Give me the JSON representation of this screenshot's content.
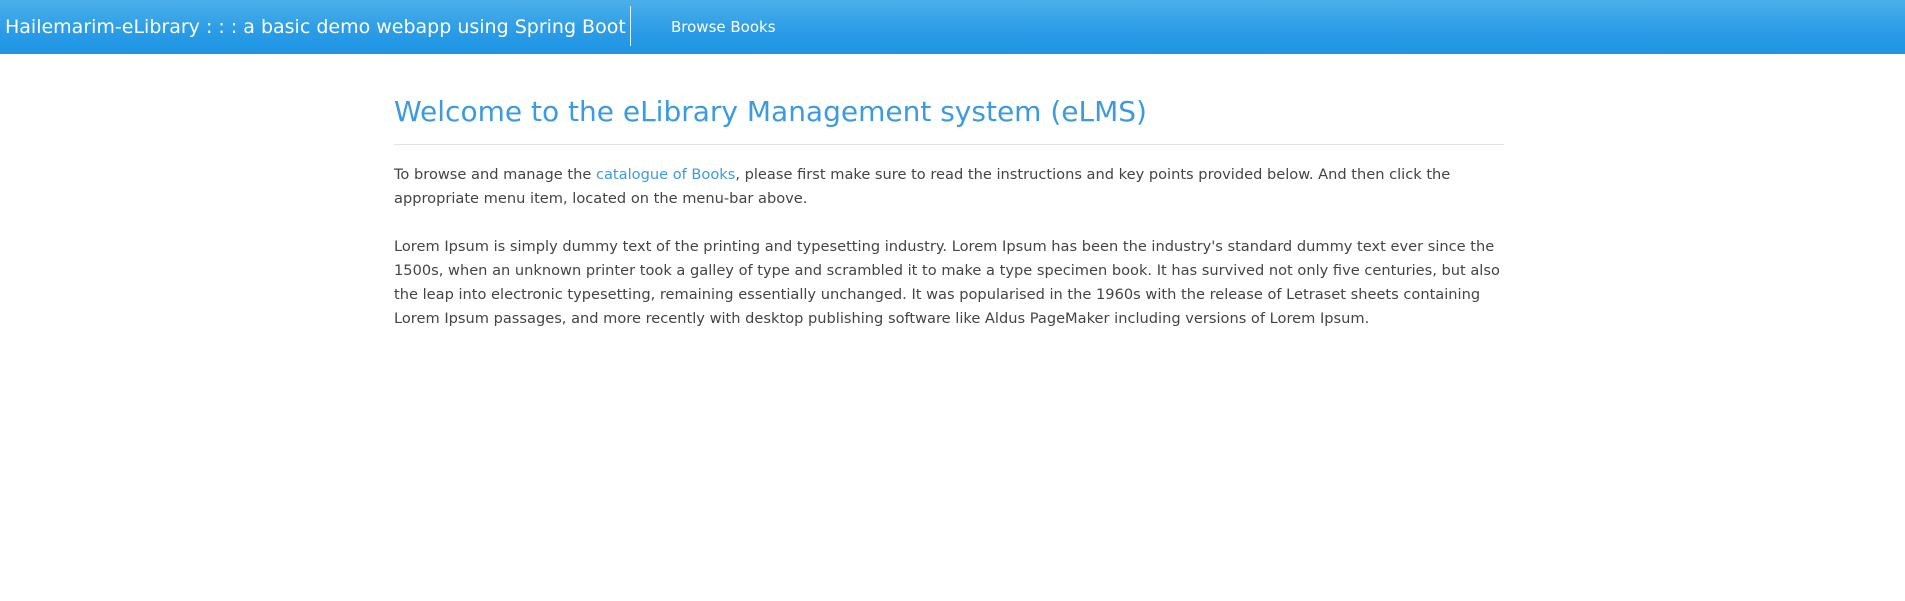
{
  "navbar": {
    "brand": "Hailemarim-eLibrary : : : a basic demo webapp using Spring Boot",
    "links": [
      {
        "label": "Browse Books"
      }
    ]
  },
  "main": {
    "title": "Welcome to the eLibrary Management system (eLMS)",
    "intro": {
      "before_link": "To browse and manage the ",
      "link_text": "catalogue of Books",
      "after_link": ", please first make sure to read the instructions and key points provided below. And then click the appropriate menu item, located on the menu-bar above."
    },
    "lorem": "Lorem Ipsum is simply dummy text of the printing and typesetting industry. Lorem Ipsum has been the industry's standard dummy text ever since the 1500s, when an unknown printer took a galley of type and scrambled it to make a type specimen book. It has survived not only five centuries, but also the leap into electronic typesetting, remaining essentially unchanged. It was popularised in the 1960s with the release of Letraset sheets containing Lorem Ipsum passages, and more recently with desktop publishing software like Aldus PageMaker including versions of Lorem Ipsum."
  },
  "colors": {
    "navbar_top": "#4cb0ea",
    "navbar_bottom": "#1e95e3",
    "accent": "#3c9be0",
    "body_text": "#444444"
  }
}
